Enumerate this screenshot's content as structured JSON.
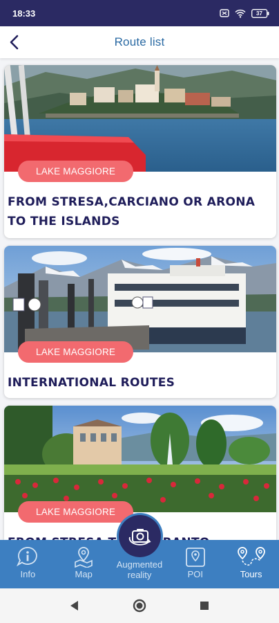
{
  "status_bar": {
    "time": "18:33",
    "battery": "37"
  },
  "header": {
    "title": "Route list"
  },
  "routes": [
    {
      "badge": "LAKE MAGGIORE",
      "title": "FROM STRESA,CARCIANO OR ARONA TO THE ISLANDS"
    },
    {
      "badge": "LAKE MAGGIORE",
      "title": "INTERNATIONAL ROUTES"
    },
    {
      "badge": "LAKE MAGGIORE",
      "title": "FROM STRESA T… A TARANTO"
    }
  ],
  "bottom_nav": {
    "items": [
      {
        "label": "Info",
        "icon": "info-icon"
      },
      {
        "label": "Map",
        "icon": "map-pin-icon"
      },
      {
        "label": "Augmented reality",
        "icon": "camera-rotate-icon"
      },
      {
        "label": "POI",
        "icon": "poi-icon"
      },
      {
        "label": "Tours",
        "icon": "tours-icon",
        "active": true
      }
    ]
  },
  "colors": {
    "status_bar": "#2b2a63",
    "title_blue": "#2a6aa3",
    "badge": "#f26a6f",
    "card_title": "#1f1d5a",
    "nav_bg": "#3d7fc1"
  }
}
